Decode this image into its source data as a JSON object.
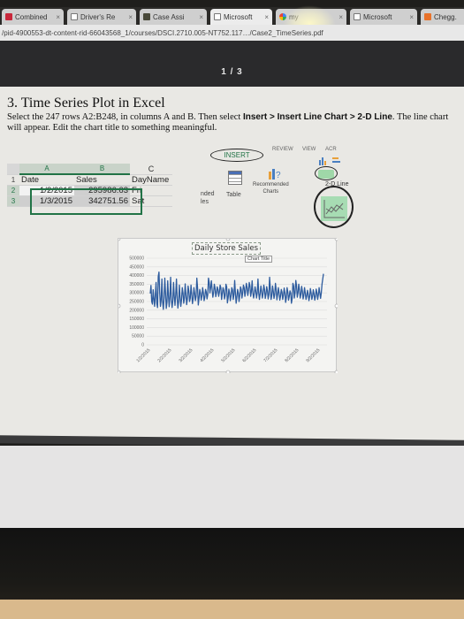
{
  "browser": {
    "tabs": [
      {
        "label": "Combined",
        "icon": "combined-favicon",
        "active": false
      },
      {
        "label": "Driver's Re",
        "icon": "document-icon",
        "active": false
      },
      {
        "label": "Case Assi",
        "icon": "case-favicon",
        "active": false
      },
      {
        "label": "Microsoft",
        "icon": "document-icon",
        "active": true
      },
      {
        "label": "my",
        "icon": "google-icon",
        "active": false
      },
      {
        "label": "Microsoft",
        "icon": "document-icon",
        "active": false
      },
      {
        "label": "Chegg.",
        "icon": "chegg-icon",
        "active": false
      }
    ],
    "close_glyph": "×",
    "url": "/pid-4900553-dt-content-rid-66043568_1/courses/DSCI.2710.005-NT752.117…/Case2_TimeSeries.pdf"
  },
  "pdf": {
    "page_indicator": "1 / 3"
  },
  "document": {
    "heading": "3. Time Series Plot in Excel",
    "instructions_text_1": "Select the 247 rows A2:B248, in columns A and B. Then select ",
    "instructions_bold_1": "Insert > Insert Line Chart > 2-D Line",
    "instructions_text_2": ". The line chart will appear. Edit the chart title to something meaningful."
  },
  "spreadsheet": {
    "column_headers": [
      "A",
      "B",
      "C"
    ],
    "rows": [
      {
        "row": "1",
        "cells": [
          "Date",
          "Sales",
          "DayName"
        ]
      },
      {
        "row": "2",
        "cells": [
          "1/2/2015",
          "295986.63",
          "Fri"
        ]
      },
      {
        "row": "3",
        "cells": [
          "1/3/2015",
          "342751.56",
          "Sat"
        ]
      }
    ]
  },
  "ribbon": {
    "tabs": {
      "insert": "INSERT",
      "review": "REVIEW",
      "view": "VIEW",
      "acr": "ACR"
    },
    "recommended_tables_partial": "nded\nles",
    "table_label": "Table",
    "recommended_charts_label": "Recommended\nCharts",
    "line_chart_submenu_label": "2-D Line"
  },
  "chart_data": {
    "type": "line",
    "title": "Daily Store Sales",
    "title_tooltip": "Chart Title",
    "xlabel": "",
    "ylabel": "",
    "ylim": [
      0,
      500000
    ],
    "yticks": [
      0,
      50000,
      100000,
      150000,
      200000,
      250000,
      300000,
      350000,
      400000,
      450000,
      500000
    ],
    "xtick_labels": [
      "1/2/2015",
      "2/2/2015",
      "3/2/2015",
      "4/2/2015",
      "5/2/2015",
      "6/2/2015",
      "7/2/2015",
      "8/2/2015",
      "9/2/2015"
    ],
    "grid": true,
    "legend": "none",
    "series": [
      {
        "name": "Sales",
        "color": "#2e5c9e",
        "values": [
          295987,
          342752,
          250000,
          235000,
          318000,
          265000,
          222000,
          290000,
          360000,
          240000,
          215000,
          395000,
          420000,
          300000,
          222000,
          260000,
          380000,
          248000,
          205000,
          270000,
          385000,
          300000,
          210000,
          245000,
          370000,
          285000,
          220000,
          280000,
          390000,
          262000,
          215000,
          255000,
          360000,
          280000,
          228000,
          290000,
          380000,
          270000,
          212000,
          250000,
          345000,
          275000,
          222000,
          262000,
          330000,
          300000,
          240000,
          270000,
          352000,
          290000,
          232000,
          265000,
          340000,
          310000,
          250000,
          270000,
          345000,
          295000,
          238000,
          268000,
          330000,
          298000,
          255000,
          280000,
          385000,
          330000,
          230000,
          268000,
          320000,
          300000,
          258000,
          282000,
          330000,
          300000,
          255000,
          275000,
          320000,
          305000,
          265000,
          290000,
          385000,
          360000,
          300000,
          330000,
          370000,
          320000,
          275000,
          300000,
          350000,
          330000,
          278000,
          300000,
          335000,
          320000,
          280000,
          305000,
          345000,
          330000,
          262000,
          295000,
          330000,
          315000,
          265000,
          285000,
          350000,
          335000,
          242000,
          270000,
          322000,
          300000,
          255000,
          282000,
          330000,
          318000,
          262000,
          290000,
          372000,
          300000,
          240000,
          275000,
          320000,
          300000,
          250000,
          285000,
          335000,
          320000,
          270000,
          300000,
          345000,
          330000,
          280000,
          310000,
          355000,
          332000,
          285000,
          315000,
          360000,
          340000,
          280000,
          310000,
          370000,
          300000,
          270000,
          298000,
          335000,
          310000,
          270000,
          300000,
          380000,
          300000,
          262000,
          295000,
          340000,
          310000,
          270000,
          295000,
          345000,
          320000,
          268000,
          292000,
          336000,
          312000,
          265000,
          290000,
          390000,
          320000,
          262000,
          285000,
          340000,
          310000,
          268000,
          290000,
          355000,
          320000,
          260000,
          290000,
          330000,
          300000,
          258000,
          280000,
          320000,
          305000,
          262000,
          285000,
          328000,
          300000,
          245000,
          272000,
          330000,
          305000,
          258000,
          280000,
          312000,
          298000,
          240000,
          268000,
          355000,
          340000,
          270000,
          300000,
          372000,
          340000,
          275000,
          300000,
          350000,
          320000,
          270000,
          292000,
          338000,
          310000,
          265000,
          285000,
          330000,
          300000,
          262000,
          280000,
          315000,
          292000,
          255000,
          278000,
          325000,
          300000,
          262000,
          280000,
          318000,
          295000,
          258000,
          278000,
          322000,
          300000,
          262000,
          290000,
          330000,
          300000,
          268000,
          300000,
          350000,
          380000,
          410000
        ]
      }
    ]
  }
}
